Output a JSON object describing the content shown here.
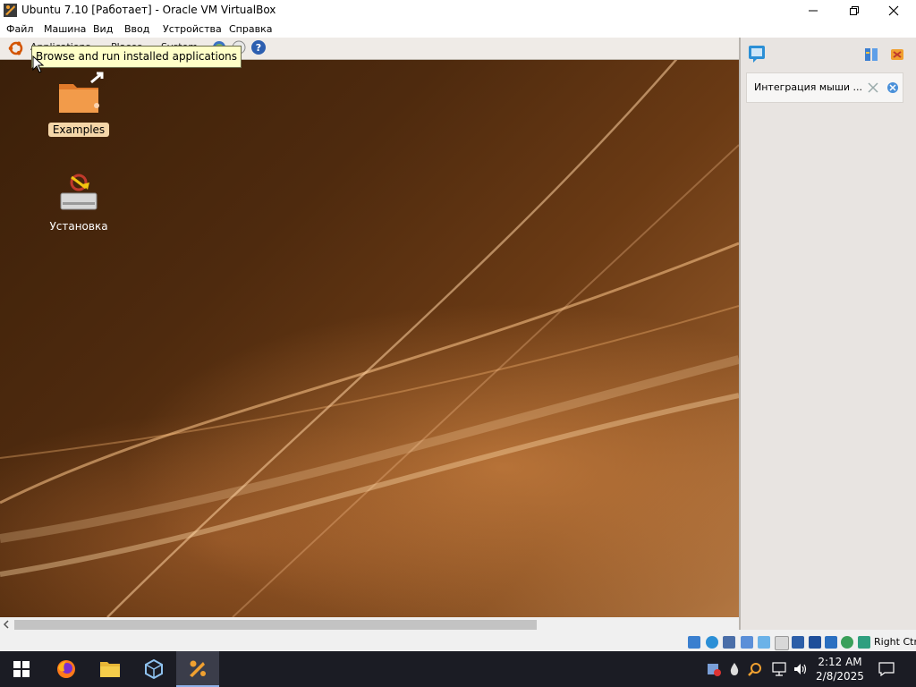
{
  "window": {
    "title": "Ubuntu 7.10 [Работает] - Oracle VM VirtualBox",
    "minimize_icon": "minimize-icon",
    "maximize_icon": "restore-icon",
    "close_icon": "close-icon"
  },
  "menubar": {
    "items": [
      "Файл",
      "Машина",
      "Вид",
      "Ввод",
      "Устройства",
      "Справка"
    ]
  },
  "guest": {
    "panel": {
      "logo_icon": "ubuntu-logo-icon",
      "items": [
        "Applications",
        "Places",
        "System"
      ],
      "quick_icons": [
        "web-browser-icon",
        "mail-icon",
        "help-icon"
      ]
    },
    "tooltip": "Browse and run installed applications",
    "desktop_icons": [
      {
        "label": "Examples",
        "icon": "folder-link-icon",
        "selected": true
      },
      {
        "label": "Установка",
        "icon": "install-drive-icon",
        "selected": false
      }
    ]
  },
  "sidebar": {
    "top_icons": [
      "notification-icon",
      "settings-icon",
      "close-all-icon"
    ],
    "notification": {
      "text": "Интеграция мыши ...",
      "icons": [
        "mouse-integration-icon",
        "dismiss-icon"
      ]
    }
  },
  "statusbar": {
    "icons": [
      "hard-disk-icon",
      "optical-drive-icon",
      "audio-icon",
      "network-icon",
      "usb-icon",
      "shared-folders-icon",
      "display-icon",
      "recording-icon",
      "virtualization-icon",
      "guest-additions-icon",
      "mouse-integration-icon"
    ],
    "host_key": "Right Ctrl"
  },
  "taskbar": {
    "apps": [
      "windows-start-icon",
      "firefox-icon",
      "file-explorer-icon",
      "virtualbox-icon",
      "virtualbox-vm-icon"
    ],
    "tray_icons": [
      "tray-app-icon",
      "tray-drop-icon",
      "tray-search-icon",
      "network-icon",
      "volume-icon"
    ],
    "time": "2:12 AM",
    "date": "2/8/2025",
    "notification_icon": "action-center-icon"
  },
  "colors": {
    "tooltip_bg": "#ffffc8",
    "taskbar_bg": "#1b1c24",
    "desktop_brown": "#4e2a0e",
    "highlight": "#f5d6a8"
  }
}
